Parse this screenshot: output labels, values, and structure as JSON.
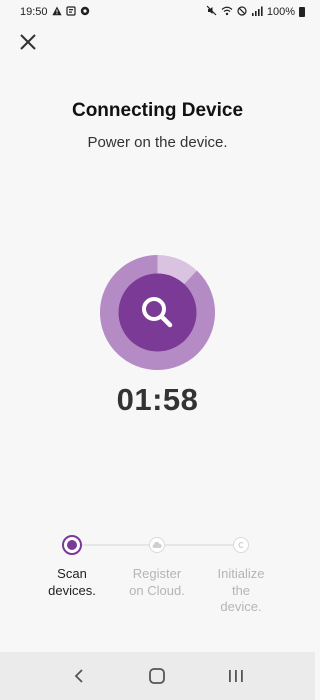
{
  "status_bar": {
    "time": "19:50",
    "battery": "100%"
  },
  "header": {
    "title": "Connecting Device",
    "subtitle": "Power on the device."
  },
  "scan": {
    "progress_fraction": 0.12,
    "timer": "01:58",
    "accent_color": "#7b3a96"
  },
  "steps": [
    {
      "label_line1": "Scan",
      "label_line2": "devices.",
      "label_line3": "",
      "state": "active"
    },
    {
      "label_line1": "Register",
      "label_line2": "on Cloud.",
      "label_line3": "",
      "state": "pending",
      "icon": "cloud-icon"
    },
    {
      "label_line1": "Initialize",
      "label_line2": "the",
      "label_line3": "device.",
      "state": "pending",
      "icon": "copyright-icon"
    }
  ]
}
